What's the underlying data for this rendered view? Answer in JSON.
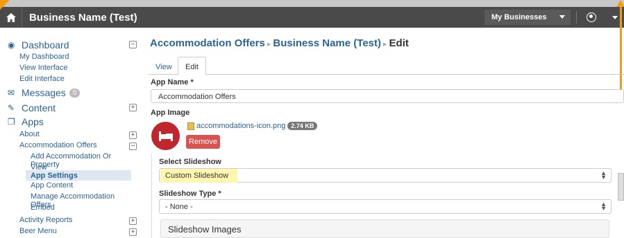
{
  "topbar": {
    "title": "Business Name (Test)",
    "my_businesses": "My Businesses"
  },
  "sidebar": {
    "dashboard": "Dashboard",
    "my_dashboard": "My Dashboard",
    "view_interface": "View Interface",
    "edit_interface": "Edit Interface",
    "messages": "Messages",
    "messages_count": "0",
    "content": "Content",
    "apps": "Apps",
    "about": "About",
    "accommodation_offers": "Accommodation Offers",
    "add_accommodation": "Add Accommodation Or Property",
    "view": "View",
    "app_settings": "App Settings",
    "app_content": "App Content",
    "manage_accommodation": "Manage Accommodation Offers",
    "embed": "Embed",
    "activity_reports": "Activity Reports",
    "beer_menu": "Beer Menu"
  },
  "breadcrumb": {
    "part1": "Accommodation Offers",
    "part2": "Business Name (Test)",
    "part3": "Edit"
  },
  "tabs": {
    "view": "View",
    "edit": "Edit"
  },
  "form": {
    "app_name_label": "App Name *",
    "app_name_value": "Accommodation Offers",
    "app_image_label": "App Image",
    "file_name": "accommodations-icon.png",
    "file_size": "2.74 KB",
    "remove": "Remove",
    "select_slideshow_label": "Select Slideshow",
    "select_slideshow_value": "Custom Slideshow",
    "slideshow_type_label": "Slideshow Type *",
    "slideshow_type_value": "- None -",
    "slideshow_images": "Slideshow Images"
  },
  "colors": {
    "topbar": "#4a4a4a",
    "link": "#2a6496",
    "remove": "#d9534f",
    "icon_bg": "#c0262d",
    "highlight": "#fff7b0",
    "annotation": "#f39c12"
  }
}
